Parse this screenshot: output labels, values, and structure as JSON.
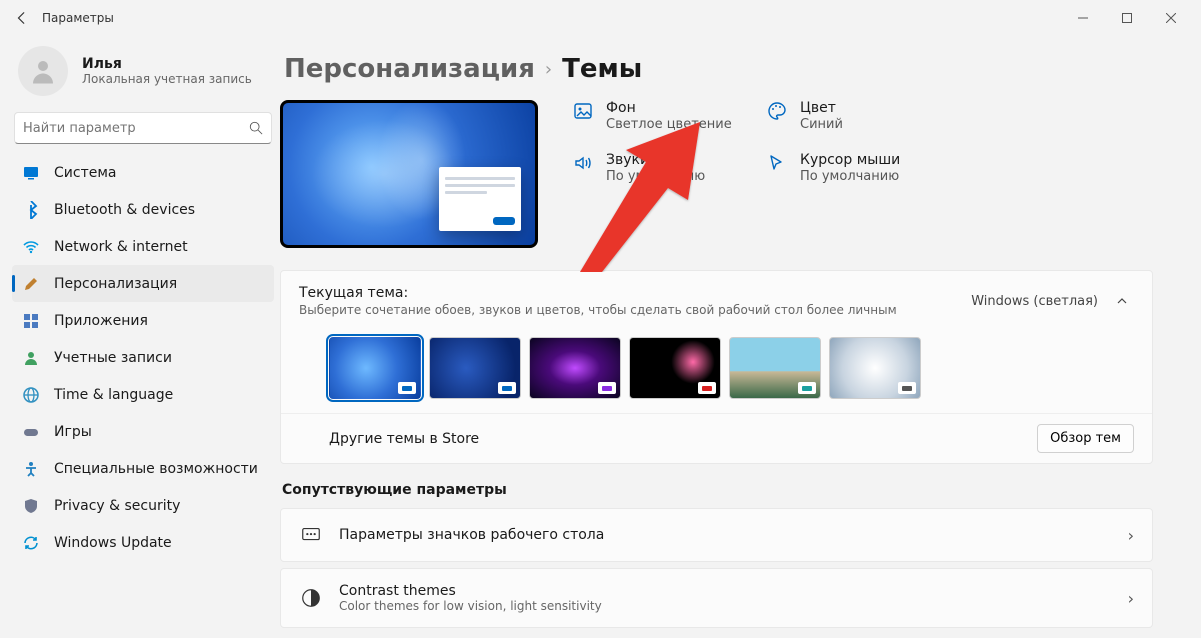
{
  "app": {
    "title": "Параметры"
  },
  "profile": {
    "name": "Илья",
    "sub": "Локальная учетная запись"
  },
  "search": {
    "placeholder": "Найти параметр"
  },
  "sidebar": {
    "items": [
      {
        "label": "Система",
        "icon": "display-icon",
        "color": "#0078d4"
      },
      {
        "label": "Bluetooth & devices",
        "icon": "bluetooth-icon",
        "color": "#0078d4"
      },
      {
        "label": "Network & internet",
        "icon": "wifi-icon",
        "color": "#0099e0"
      },
      {
        "label": "Персонализация",
        "icon": "brush-icon",
        "color": "#c08030",
        "active": true
      },
      {
        "label": "Приложения",
        "icon": "apps-icon",
        "color": "#4a7ac0"
      },
      {
        "label": "Учетные записи",
        "icon": "person-icon",
        "color": "#40a060"
      },
      {
        "label": "Time & language",
        "icon": "globe-icon",
        "color": "#3090c0"
      },
      {
        "label": "Игры",
        "icon": "gamepad-icon",
        "color": "#707890"
      },
      {
        "label": "Специальные возможности",
        "icon": "accessibility-icon",
        "color": "#2080c0"
      },
      {
        "label": "Privacy & security",
        "icon": "shield-icon",
        "color": "#707890"
      },
      {
        "label": "Windows Update",
        "icon": "update-icon",
        "color": "#0090d0"
      }
    ]
  },
  "breadcrumb": {
    "parent": "Персонализация",
    "current": "Темы"
  },
  "quick": [
    {
      "title": "Фон",
      "sub": "Светлое цветение",
      "icon": "image-icon"
    },
    {
      "title": "Цвет",
      "sub": "Синий",
      "icon": "palette-icon"
    },
    {
      "title": "Звуки",
      "sub": "По умолчанию",
      "icon": "sound-icon"
    },
    {
      "title": "Курсор мыши",
      "sub": "По умолчанию",
      "icon": "cursor-icon"
    }
  ],
  "currentTheme": {
    "title": "Текущая тема:",
    "sub": "Выберите сочетание обоев, звуков и цветов, чтобы сделать свой рабочий стол более личным",
    "expandLabel": "Windows (светлая)"
  },
  "store": {
    "label": "Другие темы в Store",
    "browse": "Обзор тем"
  },
  "related": {
    "title": "Сопутствующие параметры",
    "rows": [
      {
        "title": "Параметры значков рабочего стола",
        "sub": "",
        "icon": "desktop-icons-icon"
      },
      {
        "title": "Contrast themes",
        "sub": "Color themes for low vision, light sensitivity",
        "icon": "contrast-icon"
      }
    ]
  }
}
